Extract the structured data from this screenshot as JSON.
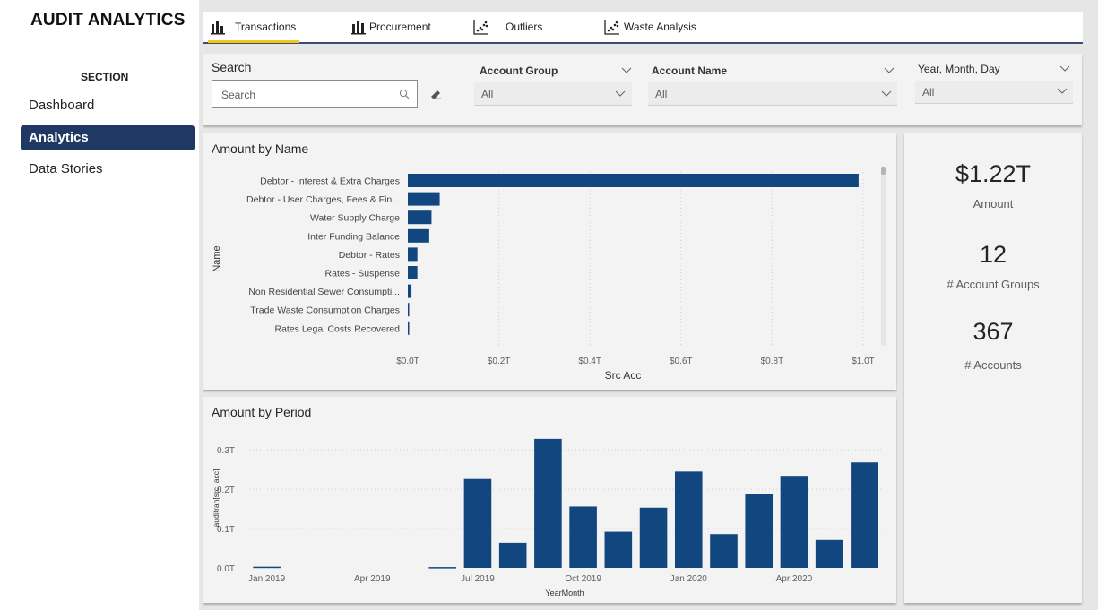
{
  "app": {
    "title": "AUDIT ANALYTICS"
  },
  "nav": {
    "heading": "SECTION",
    "items": [
      {
        "label": "Dashboard",
        "active": false
      },
      {
        "label": "Analytics",
        "active": true
      },
      {
        "label": "Data Stories",
        "active": false
      }
    ]
  },
  "tabs": [
    {
      "label": "Transactions",
      "icon": "bar-chart-icon",
      "active": true
    },
    {
      "label": "Procurement",
      "icon": "bar-chart-icon",
      "active": false
    },
    {
      "label": "Outliers",
      "icon": "scatter-chart-icon",
      "active": false
    },
    {
      "label": "Waste Analysis",
      "icon": "scatter-chart-icon",
      "active": false
    }
  ],
  "filters": {
    "search": {
      "label": "Search",
      "placeholder": "Search"
    },
    "account_group": {
      "label": "Account Group",
      "value": "All"
    },
    "account_name": {
      "label": "Account Name",
      "value": "All"
    },
    "date": {
      "label": "Year, Month, Day",
      "value": "All"
    }
  },
  "kpis": [
    {
      "value": "$1.22T",
      "label": "Amount"
    },
    {
      "value": "12",
      "label": "# Account Groups"
    },
    {
      "value": "367",
      "label": "# Accounts"
    }
  ],
  "colors": {
    "bar": "#12467f",
    "accent": "#f2c811",
    "nav_active": "#1f3864"
  },
  "chart_data": [
    {
      "type": "bar",
      "orientation": "horizontal",
      "title": "Amount by Name",
      "xlabel": "Src Acc",
      "ylabel": "Name",
      "categories": [
        "Debtor - Interest & Extra Charges",
        "Debtor - User Charges, Fees & Fin...",
        "Water Supply Charge",
        "Inter Funding Balance",
        "Debtor - Rates",
        "Rates - Suspense",
        "Non Residential Sewer Consumpti...",
        "Trade Waste Consumption Charges",
        "Rates Legal Costs Recovered"
      ],
      "values": [
        0.99,
        0.07,
        0.052,
        0.047,
        0.021,
        0.021,
        0.008,
        0.002,
        0.002
      ],
      "xlim": [
        0,
        1.0
      ],
      "xticks": [
        "$0.0T",
        "$0.2T",
        "$0.4T",
        "$0.6T",
        "$0.8T",
        "$1.0T"
      ],
      "grid": true
    },
    {
      "type": "bar",
      "title": "Amount by Period",
      "xlabel": "YearMonth",
      "ylabel": "auditran[src_acc]",
      "categories": [
        "2019-01",
        "2019-02",
        "2019-03",
        "2019-04",
        "2019-05",
        "2019-06",
        "2019-07",
        "2019-08",
        "2019-09",
        "2019-10",
        "2019-11",
        "2019-12",
        "2020-01",
        "2020-02",
        "2020-03",
        "2020-04",
        "2020-05",
        "2020-06"
      ],
      "values": [
        0.003,
        0,
        0,
        0,
        0,
        0.002,
        0.226,
        0.064,
        0.328,
        0.156,
        0.092,
        0.153,
        0.245,
        0.086,
        0.187,
        0.234,
        0.071,
        0.268
      ],
      "ylim": [
        0,
        0.33
      ],
      "yticks": [
        "0.0T",
        "0.1T",
        "0.2T",
        "0.3T"
      ],
      "xticks": [
        "Jan 2019",
        "Apr 2019",
        "Jul 2019",
        "Oct 2019",
        "Jan 2020",
        "Apr 2020"
      ],
      "grid": true
    }
  ]
}
